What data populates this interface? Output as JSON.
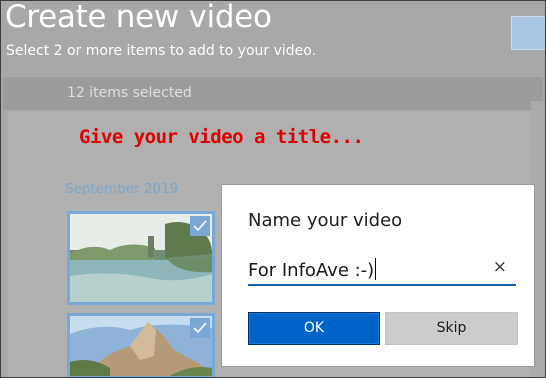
{
  "header": {
    "title": "Create new video",
    "subtitle": "Select 2 or more items to add to your video.",
    "selected_count": "12 items selected"
  },
  "annotation": "Give your video a title...",
  "gallery": {
    "month": "September 2019",
    "thumbnails": [
      {
        "selected": true
      },
      {
        "selected": true
      }
    ]
  },
  "dialog": {
    "title": "Name your video",
    "input_value": "For InfoAve :-)",
    "clear_icon": "×",
    "ok_label": "OK",
    "skip_label": "Skip"
  },
  "colors": {
    "accent": "#0063c7",
    "selection_border": "#7aa8d6",
    "annotation": "#e10000"
  }
}
